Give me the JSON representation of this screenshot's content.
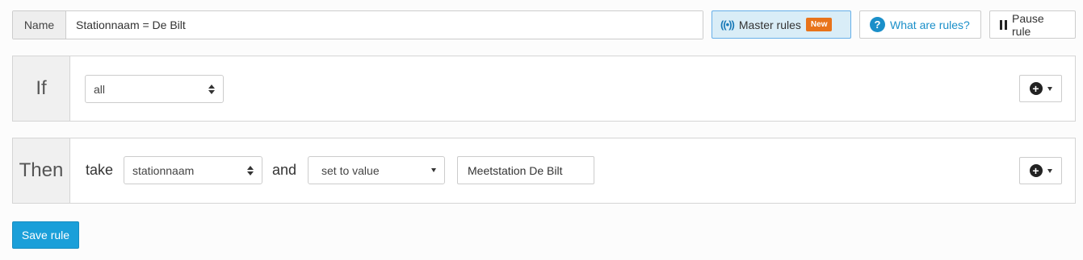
{
  "header": {
    "name_label": "Name",
    "name_value": "Stationnaam = De Bilt",
    "master_rules_label": "Master rules",
    "master_rules_badge": "New",
    "help_label": "What are rules?",
    "pause_label": "Pause rule"
  },
  "if_panel": {
    "heading": "If",
    "match_select": "all"
  },
  "then_panel": {
    "heading": "Then",
    "take_text": "take",
    "field_select": "stationnaam",
    "and_text": "and",
    "action_select": "set to value",
    "value": "Meetstation De Bilt"
  },
  "footer": {
    "save_label": "Save rule"
  },
  "colors": {
    "accent": "#1a9fd9",
    "badge": "#e8731a",
    "master_bg": "#d9edf7"
  }
}
